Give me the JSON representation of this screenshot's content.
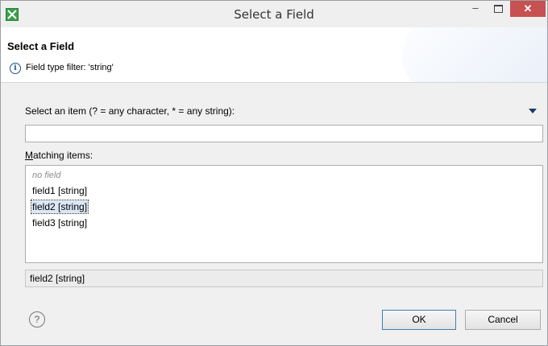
{
  "window": {
    "title": "Select a Field",
    "close_glyph": "✕",
    "minimize_glyph": "–"
  },
  "header": {
    "title": "Select a Field",
    "info_text": "Field type filter: 'string'"
  },
  "filter": {
    "label": "Select an item (? = any character, * = any string):",
    "value": "",
    "placeholder": ""
  },
  "matching": {
    "label_accel": "M",
    "label_rest": "atching items:"
  },
  "list": {
    "items": [
      {
        "label": "no field",
        "placeholder": true
      },
      {
        "label": "field1 [string]"
      },
      {
        "label": "field2 [string]",
        "selected": true
      },
      {
        "label": "field3 [string]"
      }
    ]
  },
  "status": {
    "value": "field2 [string]"
  },
  "buttons": {
    "ok": "OK",
    "cancel": "Cancel",
    "help_glyph": "?"
  },
  "colors": {
    "close_button": "#c75050",
    "selection": "#dbe7f6",
    "app_icon": "#3aa04a"
  }
}
